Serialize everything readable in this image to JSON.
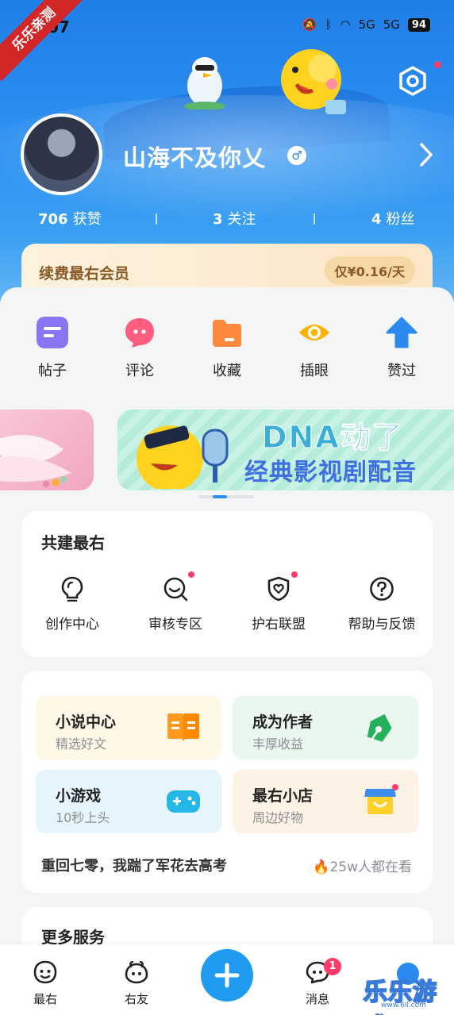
{
  "status_bar": {
    "time": "07",
    "battery": "94",
    "signal1": "5G",
    "signal2": "5G"
  },
  "watermark_ribbon": "乐乐亲测",
  "profile": {
    "username": "山海不及你乂",
    "gender_symbol": "♂",
    "stats": [
      {
        "value": "706",
        "label": "获赞"
      },
      {
        "value": "3",
        "label": "关注"
      },
      {
        "value": "4",
        "label": "粉丝"
      }
    ]
  },
  "vip": {
    "title": "续费最右会员",
    "price": "仅¥0.16/天"
  },
  "quick_actions": [
    {
      "label": "帖子",
      "icon": "post-icon",
      "color": "#8a74f3"
    },
    {
      "label": "评论",
      "icon": "comment-icon",
      "color": "#ff5d7f"
    },
    {
      "label": "收藏",
      "icon": "folder-icon",
      "color": "#ff8a3d"
    },
    {
      "label": "插眼",
      "icon": "eye-icon",
      "color": "#ffb300"
    },
    {
      "label": "赞过",
      "icon": "thumb-up-icon",
      "color": "#2a8aee"
    }
  ],
  "banner": {
    "line1": "DNA动了",
    "line2": "经典影视剧配音"
  },
  "co_build": {
    "title": "共建最右",
    "items": [
      {
        "label": "创作中心",
        "icon": "lightbulb-icon",
        "dot": false
      },
      {
        "label": "审核专区",
        "icon": "search-review-icon",
        "dot": true
      },
      {
        "label": "护右联盟",
        "icon": "shield-heart-icon",
        "dot": true
      },
      {
        "label": "帮助与反馈",
        "icon": "help-icon",
        "dot": false
      }
    ]
  },
  "features": {
    "tiles": [
      {
        "title": "小说中心",
        "subtitle": "精选好文",
        "icon": "book-icon",
        "bg": "#fff8e6"
      },
      {
        "title": "成为作者",
        "subtitle": "丰厚收益",
        "icon": "pen-icon",
        "bg": "#eaf7ee"
      },
      {
        "title": "小游戏",
        "subtitle": "10秒上头",
        "icon": "gamepad-icon",
        "bg": "#e6f4fd"
      },
      {
        "title": "最右小店",
        "subtitle": "周边好物",
        "icon": "shop-icon",
        "bg": "#fdf2e3"
      }
    ],
    "trending_title": "重回七零，我踹了军花去高考",
    "trending_views": "25w人都在看"
  },
  "more_services": {
    "title": "更多服务"
  },
  "bottom_nav": {
    "items": [
      {
        "label": "最右",
        "icon": "home-face-icon"
      },
      {
        "label": "右友",
        "icon": "friends-icon"
      },
      {
        "label": "消息",
        "icon": "message-icon"
      }
    ],
    "message_badge": "1"
  },
  "watermark": {
    "text": "乐乐游戏",
    "url": "www.6ll.com"
  }
}
